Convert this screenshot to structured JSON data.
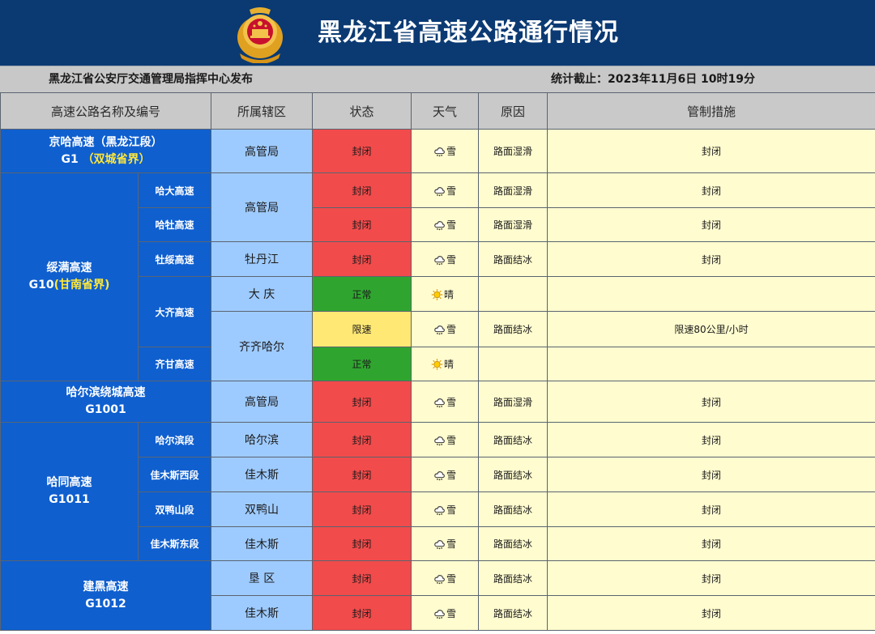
{
  "header": {
    "title": "黑龙江省高速公路通行情况",
    "publisher": "黑龙江省公安厅交通管理局指挥中心发布",
    "cutoff": "统计截止：2023年11月6日 10时19分"
  },
  "columns": [
    "高速公路名称及编号",
    "所属辖区",
    "状态",
    "天气",
    "原因",
    "管制措施"
  ],
  "highways": {
    "g1": {
      "name": "京哈高速（黑龙江段）",
      "code": "G1",
      "note": "（双城省界）"
    },
    "g10": {
      "name": "绥满高速",
      "code": "G10",
      "note": "(甘南省界)"
    },
    "g1001": {
      "name": "哈尔滨绕城高速",
      "code": "G1001"
    },
    "g1011": {
      "name": "哈同高速",
      "code": "G1011"
    },
    "g1012": {
      "name": "建黑高速",
      "code": "G1012"
    }
  },
  "sections": [
    "哈大高速",
    "哈牡高速",
    "牡绥高速",
    "大齐高速",
    "齐甘高速",
    "哈尔滨段",
    "佳木斯西段",
    "双鸭山段",
    "佳木斯东段"
  ],
  "rows": [
    {
      "district": "高管局",
      "status": "封闭",
      "weather": "雪",
      "reason": "路面湿滑",
      "measure": "封闭"
    },
    {
      "district": "高管局",
      "status": "封闭",
      "weather": "雪",
      "reason": "路面湿滑",
      "measure": "封闭"
    },
    {
      "district": "",
      "status": "封闭",
      "weather": "雪",
      "reason": "路面湿滑",
      "measure": "封闭"
    },
    {
      "district": "牡丹江",
      "status": "封闭",
      "weather": "雪",
      "reason": "路面结冰",
      "measure": "封闭"
    },
    {
      "district": "大 庆",
      "status": "正常",
      "weather": "晴",
      "reason": "",
      "measure": ""
    },
    {
      "district": "齐齐哈尔",
      "status": "限速",
      "weather": "雪",
      "reason": "路面结冰",
      "measure": "限速80公里/小时"
    },
    {
      "district": "",
      "status": "正常",
      "weather": "晴",
      "reason": "",
      "measure": ""
    },
    {
      "district": "高管局",
      "status": "封闭",
      "weather": "雪",
      "reason": "路面湿滑",
      "measure": "封闭"
    },
    {
      "district": "哈尔滨",
      "status": "封闭",
      "weather": "雪",
      "reason": "路面结冰",
      "measure": "封闭"
    },
    {
      "district": "佳木斯",
      "status": "封闭",
      "weather": "雪",
      "reason": "路面结冰",
      "measure": "封闭"
    },
    {
      "district": "双鸭山",
      "status": "封闭",
      "weather": "雪",
      "reason": "路面结冰",
      "measure": "封闭"
    },
    {
      "district": "佳木斯",
      "status": "封闭",
      "weather": "雪",
      "reason": "路面结冰",
      "measure": "封闭"
    },
    {
      "district": "垦 区",
      "status": "封闭",
      "weather": "雪",
      "reason": "路面结冰",
      "measure": "封闭"
    },
    {
      "district": "佳木斯",
      "status": "封闭",
      "weather": "雪",
      "reason": "路面结冰",
      "measure": "封闭"
    }
  ],
  "icons": {
    "snow": "snow-cloud-icon",
    "sunny": "sun-icon",
    "emblem": "police-emblem-icon"
  },
  "colors": {
    "banner": "#0b3a73",
    "highway": "#0f5fcf",
    "district": "#9ecbff",
    "closed": "#f24b4b",
    "normal": "#2fa52f",
    "limit": "#ffe873",
    "info": "#fffccf",
    "highlight": "#ffe83a"
  }
}
